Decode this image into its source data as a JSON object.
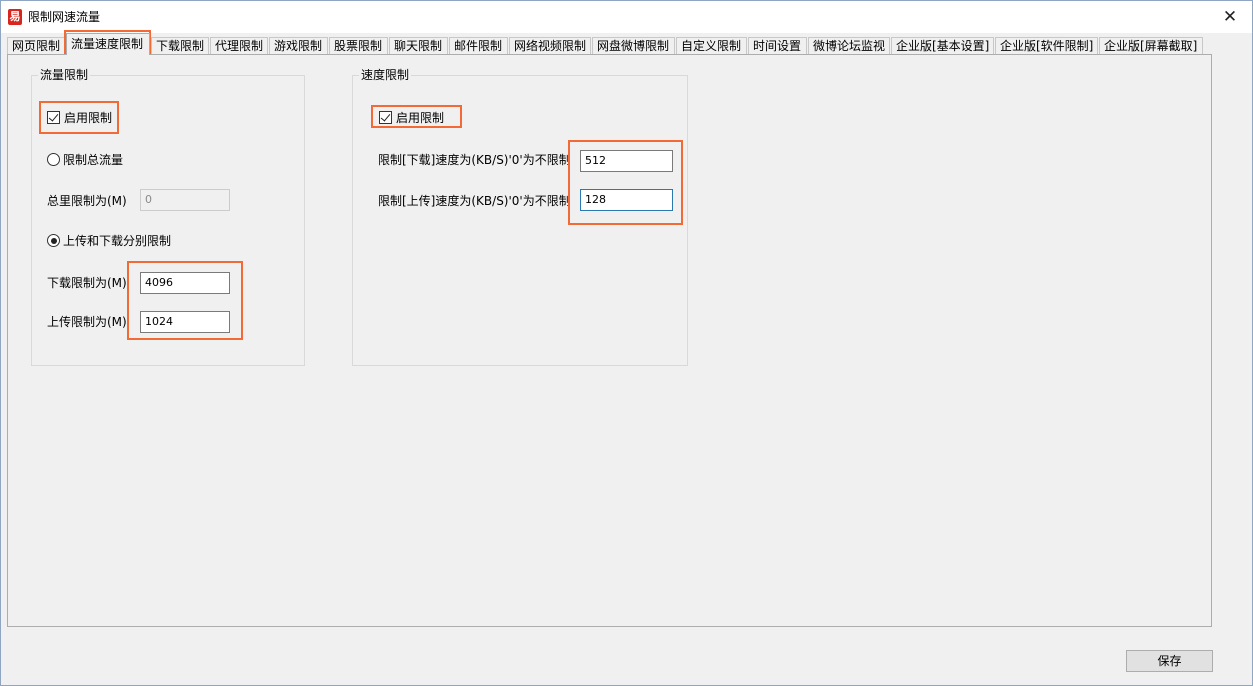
{
  "window": {
    "title": "限制网速流量",
    "icon_glyph": "易",
    "icon_color": "#d8261e",
    "close_glyph": "✕"
  },
  "tabs": [
    {
      "label": "网页限制"
    },
    {
      "label": "流量速度限制",
      "active": true
    },
    {
      "label": "下载限制"
    },
    {
      "label": "代理限制"
    },
    {
      "label": "游戏限制"
    },
    {
      "label": "股票限制"
    },
    {
      "label": "聊天限制"
    },
    {
      "label": "邮件限制"
    },
    {
      "label": "网络视频限制"
    },
    {
      "label": "网盘微博限制"
    },
    {
      "label": "自定义限制"
    },
    {
      "label": "时间设置"
    },
    {
      "label": "微博论坛监视"
    },
    {
      "label": "企业版[基本设置]"
    },
    {
      "label": "企业版[软件限制]"
    },
    {
      "label": "企业版[屏幕截取]"
    }
  ],
  "traffic": {
    "title": "流量限制",
    "enable_label": "启用限制",
    "enabled": true,
    "total_radio_label": "限制总流量",
    "total_label": "总里限制为(M)",
    "total_value": "0",
    "split_radio_label": "上传和下载分别限制",
    "download_label": "下载限制为(M)",
    "download_value": "4096",
    "upload_label": "上传限制为(M)",
    "upload_value": "1024"
  },
  "speed": {
    "title": "速度限制",
    "enable_label": "启用限制",
    "enabled": true,
    "download_label": "限制[下载]速度为(KB/S)'0'为不限制",
    "download_value": "512",
    "upload_label": "限制[上传]速度为(KB/S)'0'为不限制",
    "upload_value": "128"
  },
  "footer": {
    "save_label": "保存"
  },
  "highlight_color": "#f26a35"
}
